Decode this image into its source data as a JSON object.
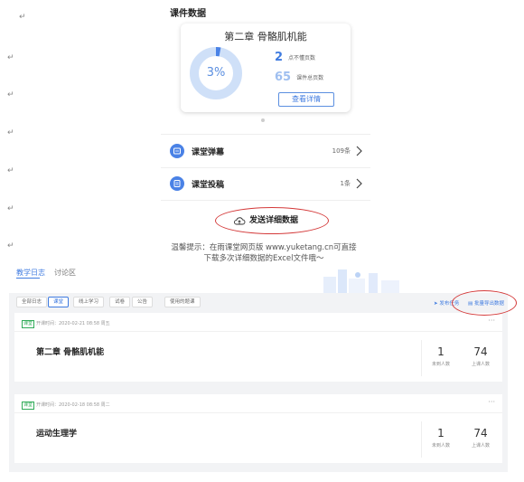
{
  "paragraph_mark": "↵",
  "phone": {
    "section_title": "课件数据",
    "card": {
      "title": "第二章 骨骼肌机能",
      "progress_percent": 3,
      "progress_label": "3%",
      "unread_num": "2",
      "unread_label": "点不懂页数",
      "total_num": "65",
      "total_label": "课件总页数",
      "detail_button": "查看详情"
    },
    "rows": [
      {
        "label": "课堂弹幕",
        "count": "109条"
      },
      {
        "label": "课堂投稿",
        "count": "1条"
      }
    ],
    "send_label": "发送详细数据",
    "tip_line1": "温馨提示：在雨课堂网页版 www.yuketang.cn可直接",
    "tip_line2": "下载多次详细数据的Excel文件哦～"
  },
  "web": {
    "tabs": [
      "教学日志",
      "讨论区"
    ],
    "chips": [
      "全部日志",
      "课堂",
      "线上学习",
      "试卷",
      "公告",
      "使用的题课"
    ],
    "active_chip": 1,
    "publish_label": "发布任务",
    "export_label": "批量导出数据",
    "lessons": [
      {
        "badge": "课堂",
        "start": "开课时间：2020-02-21 08:58 周五",
        "name": "第二章 骨骼肌机能",
        "absent": "1",
        "absent_label": "未到人数",
        "present": "74",
        "present_label": "上课人数",
        "more": "···"
      },
      {
        "badge": "课堂",
        "start": "开课时间：2020-02-18 08:58 周二",
        "name": "运动生理学",
        "absent": "1",
        "absent_label": "未到人数",
        "present": "74",
        "present_label": "上课人数",
        "more": "···"
      }
    ]
  },
  "colors": {
    "accent": "#3f7be0",
    "ring_track": "#cfe0f8",
    "annotation": "#d43a3a",
    "badge": "#2eaa57"
  }
}
